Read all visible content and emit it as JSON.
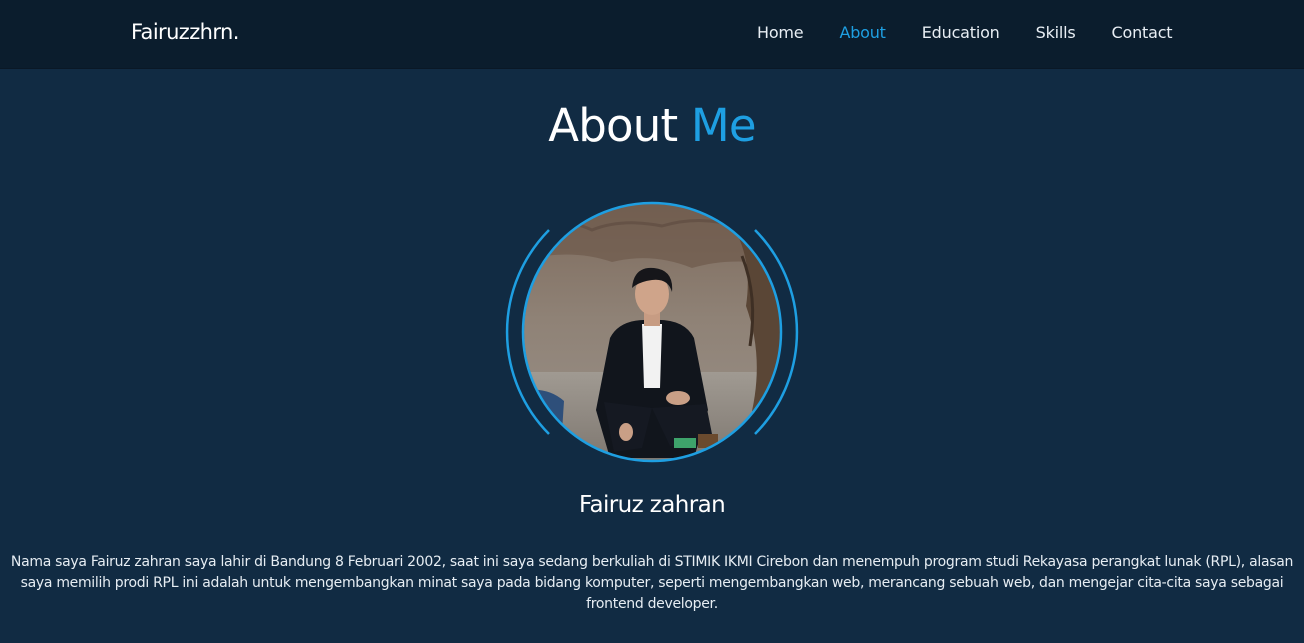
{
  "nav": {
    "brand": "Fairuzzhrn.",
    "links": [
      {
        "label": "Home",
        "active": false
      },
      {
        "label": "About",
        "active": true
      },
      {
        "label": "Education",
        "active": false
      },
      {
        "label": "Skills",
        "active": false
      },
      {
        "label": "Contact",
        "active": false
      }
    ]
  },
  "about": {
    "title_main": "About",
    "title_accent": "Me",
    "name": "Fairuz zahran",
    "bio": "Nama saya Fairuz zahran saya lahir di Bandung 8 Februari 2002, saat ini saya sedang berkuliah di STIMIK IKMI Cirebon dan menempuh program studi Rekayasa perangkat lunak (RPL), alasan saya memilih prodi RPL ini adalah untuk mengembangkan minat saya pada bidang komputer, seperti mengembangkan web, merancang sebuah web, dan mengejar cita-cita saya sebagai frontend developer."
  },
  "colors": {
    "background": "#112b43",
    "navbar": "#0b1d2d",
    "accent": "#1e9fe2",
    "text": "#ffffff"
  }
}
